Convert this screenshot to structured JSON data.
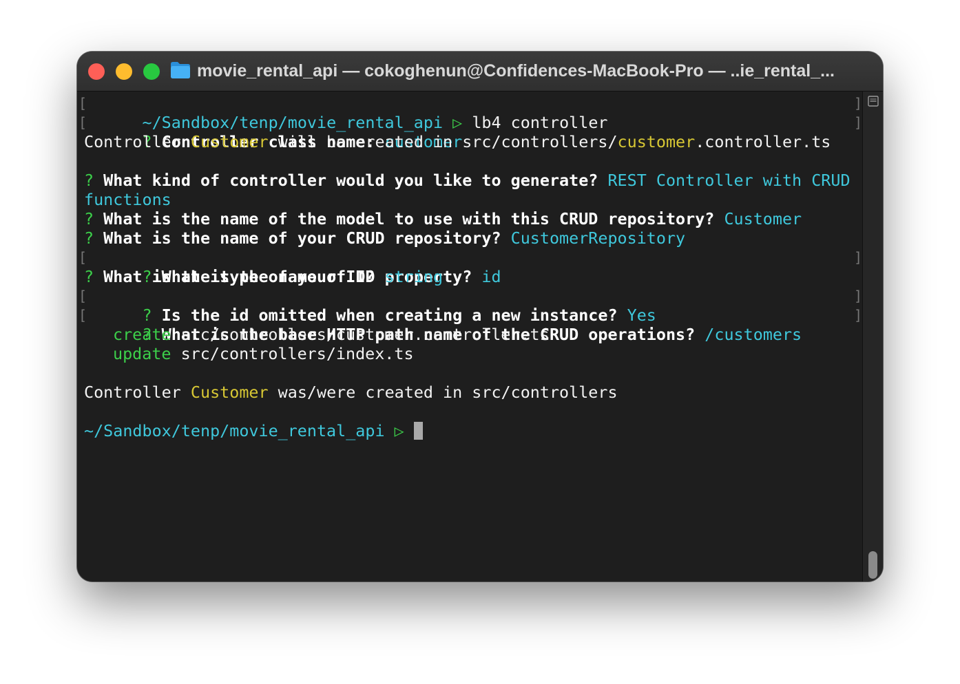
{
  "window": {
    "title": "movie_rental_api — cokoghenun@Confidences-MacBook-Pro — ..ie_rental_..."
  },
  "terminal": {
    "prompt_path": "~/Sandbox/tenp/movie_rental_api",
    "prompt_symbol": "▷",
    "command": " lb4 controller",
    "q_mark": "?",
    "line_marker_left": "[",
    "line_marker_right": "]",
    "lines": {
      "class_name_q": " Controller class name: ",
      "class_name_a": "customer",
      "will_be_1": "Controller ",
      "will_be_2": "Customer",
      "will_be_3": " will be created in src/controllers/",
      "will_be_4": "customer",
      "will_be_5": ".controller.ts",
      "kind_q": " What kind of controller would you like to generate? ",
      "kind_a1": "REST Controller with CRUD",
      "kind_a2": "functions",
      "model_q": " What is the name of the model to use with this CRUD repository? ",
      "model_a": "Customer",
      "repo_q": " What is the name of your CRUD repository? ",
      "repo_a": "CustomerRepository",
      "id_prop_q": " What is the name of ID property? ",
      "id_prop_a": "id",
      "id_type_q": " What is the type of your ID? ",
      "id_type_a": "string",
      "omit_q": " Is the id omitted when creating a new instance? ",
      "omit_a": "Yes",
      "path_q": " What is the base HTTP path name of the CRUD operations? ",
      "path_a": "/customers",
      "create_label": "create",
      "create_file": " src/controllers/customer.controller.ts",
      "update_label": "update",
      "update_file": " src/controllers/index.ts",
      "created_1": "Controller ",
      "created_2": "Customer",
      "created_3": " was/were created in src/controllers"
    }
  },
  "colors": {
    "background": "#1e1e1e",
    "path": "#3fc8dc",
    "answer": "#3fc8dc",
    "prompt_symbol": "#3ccf4a",
    "question_mark": "#3ccf4a",
    "highlight": "#d7c734"
  },
  "icons": {
    "folder": "folder-icon",
    "split": "split-pane-icon"
  }
}
